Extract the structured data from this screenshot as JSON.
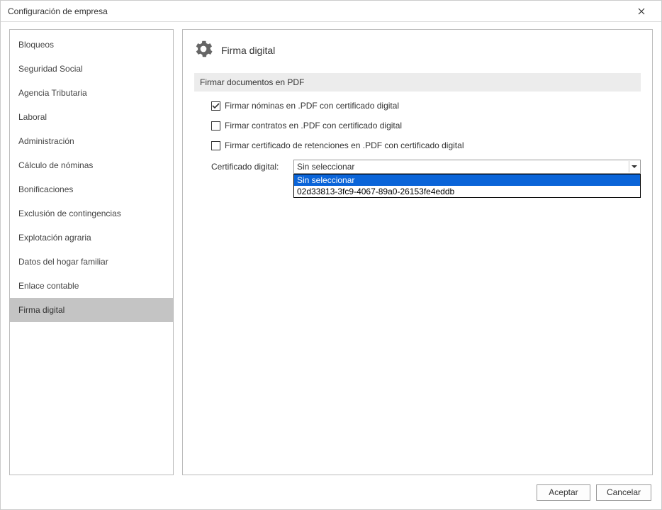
{
  "window": {
    "title": "Configuración de empresa"
  },
  "sidebar": {
    "items": [
      {
        "label": "Bloqueos",
        "selected": false
      },
      {
        "label": "Seguridad Social",
        "selected": false
      },
      {
        "label": "Agencia Tributaria",
        "selected": false
      },
      {
        "label": "Laboral",
        "selected": false
      },
      {
        "label": "Administración",
        "selected": false
      },
      {
        "label": "Cálculo de nóminas",
        "selected": false
      },
      {
        "label": "Bonificaciones",
        "selected": false
      },
      {
        "label": "Exclusión de contingencias",
        "selected": false
      },
      {
        "label": "Explotación agraria",
        "selected": false
      },
      {
        "label": "Datos del hogar familiar",
        "selected": false
      },
      {
        "label": "Enlace contable",
        "selected": false
      },
      {
        "label": "Firma digital",
        "selected": true
      }
    ]
  },
  "main": {
    "title": "Firma digital",
    "section_header": "Firmar documentos en PDF",
    "checkboxes": [
      {
        "label": "Firmar nóminas en .PDF con certificado digital",
        "checked": true
      },
      {
        "label": "Firmar contratos en .PDF con certificado digital",
        "checked": false
      },
      {
        "label": "Firmar certificado de retenciones en .PDF con certificado digital",
        "checked": false
      }
    ],
    "cert_label": "Certificado digital:",
    "cert_value": "Sin seleccionar",
    "cert_options": [
      {
        "label": "Sin seleccionar",
        "highlighted": true
      },
      {
        "label": "02d33813-3fc9-4067-89a0-26153fe4eddb",
        "highlighted": false
      }
    ]
  },
  "footer": {
    "accept": "Aceptar",
    "cancel": "Cancelar"
  }
}
